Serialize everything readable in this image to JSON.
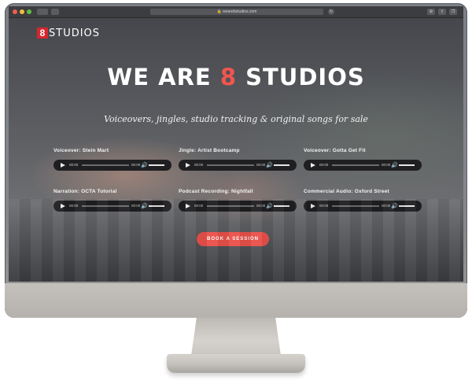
{
  "browser": {
    "url": "wearebstudios.com"
  },
  "site": {
    "logo_mark": "8",
    "logo_text": "STUDIOS",
    "headline_part1": "WE ARE",
    "headline_accent": "8",
    "headline_part2": "STUDIOS",
    "tagline": "Voiceovers, jingles, studio tracking & original songs for sale",
    "cta_label": "BOOK A SESSION"
  },
  "tracks": [
    {
      "title": "Voiceover: Stein Mart",
      "time_start": "00:00",
      "time_end": "00:00"
    },
    {
      "title": "Jingle: Artist Bootcamp",
      "time_start": "00:00",
      "time_end": "00:00"
    },
    {
      "title": "Voiceover: Gotta Get Fit",
      "time_start": "00:00",
      "time_end": "00:00"
    },
    {
      "title": "Narration: OCTA Tutorial",
      "time_start": "00:00",
      "time_end": "00:00"
    },
    {
      "title": "Podcast Recording: Nightfall",
      "time_start": "00:00",
      "time_end": "00:00"
    },
    {
      "title": "Commercial Audio: Oxford Street",
      "time_start": "00:00",
      "time_end": "00:00"
    }
  ],
  "colors": {
    "accent": "#f2554f",
    "logo_red": "#d6262d",
    "cta": "#e9514a"
  }
}
